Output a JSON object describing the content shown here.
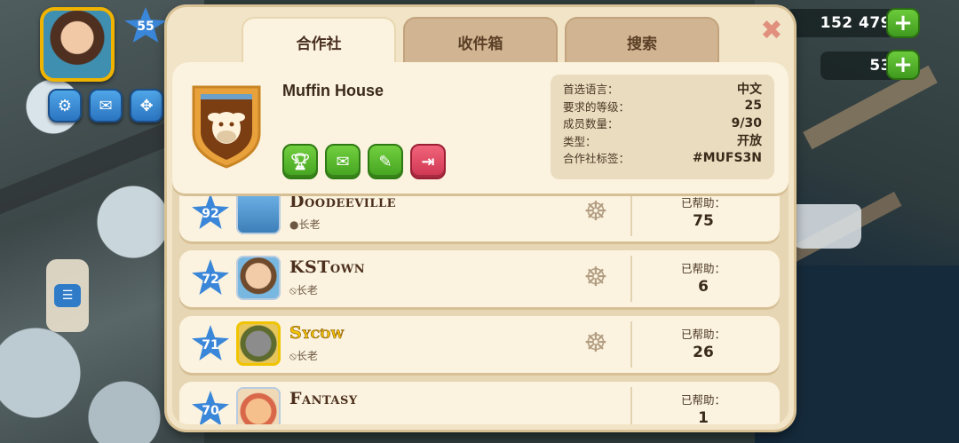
{
  "hud": {
    "player_level": "55",
    "coins": "152 479",
    "cash": "53"
  },
  "modal": {
    "tabs": [
      {
        "label": "合作社",
        "active": true
      },
      {
        "label": "收件箱",
        "active": false
      },
      {
        "label": "搜索",
        "active": false
      }
    ],
    "coop": {
      "name": "Muffin House",
      "stats": [
        {
          "label": "首选语言：",
          "value": "中文"
        },
        {
          "label": "要求的等级：",
          "value": "25"
        },
        {
          "label": "成员数量：",
          "value": "9/30"
        },
        {
          "label": "类型：",
          "value": "开放"
        },
        {
          "label": "合作社标签：",
          "value": "#MUFS3N"
        }
      ]
    },
    "members": [
      {
        "level": "92",
        "name": "Doodeeville",
        "role": "●长老",
        "helped_label": "已帮助：",
        "helped": "75",
        "highlight": false
      },
      {
        "level": "72",
        "name": "KSTown",
        "role": "⦸长老",
        "helped_label": "已帮助：",
        "helped": "6",
        "highlight": false
      },
      {
        "level": "71",
        "name": "Sycόw",
        "role": "⦸长老",
        "helped_label": "已帮助：",
        "helped": "26",
        "highlight": true
      },
      {
        "level": "70",
        "name": "Fantasy",
        "role": "",
        "helped_label": "已帮助：",
        "helped": "1",
        "highlight": false
      }
    ]
  },
  "colors": {
    "panel_bg": "#f1e4c7",
    "star_blue": "#3a86d8",
    "button_green": "#43a21f",
    "button_red": "#cf3550"
  },
  "icons": {
    "close": "close-icon",
    "trophy": "trophy-icon",
    "mail": "mail-icon",
    "edit": "pencil-icon",
    "leave": "exit-icon",
    "helm": "ship-wheel-icon"
  }
}
